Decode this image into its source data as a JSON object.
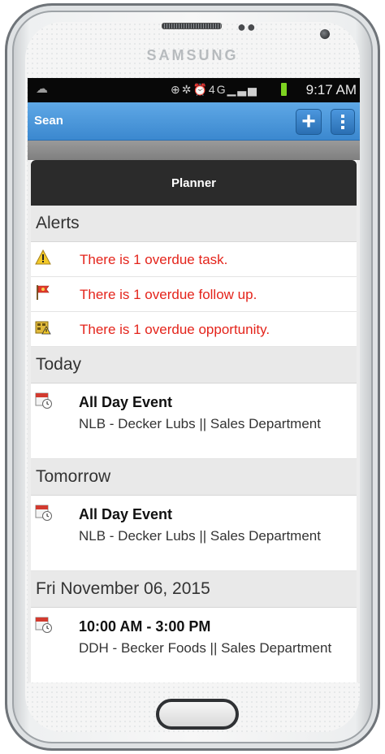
{
  "device": {
    "brand": "SAMSUNG"
  },
  "statusbar": {
    "time": "9:17 AM",
    "network": "4G"
  },
  "appbar": {
    "title": "Sean",
    "add_label": "+"
  },
  "planner": {
    "title": "Planner"
  },
  "alerts": {
    "heading": "Alerts",
    "items": [
      {
        "text": "There is 1 overdue task.",
        "icon": "warning-icon"
      },
      {
        "text": "There is 1 overdue follow up.",
        "icon": "flag-icon"
      },
      {
        "text": "There is 1 overdue opportunity.",
        "icon": "opportunity-icon"
      }
    ]
  },
  "sections": [
    {
      "heading": "Today",
      "event": {
        "title": "All Day Event",
        "detail": "NLB - Decker Lubs || Sales Department"
      }
    },
    {
      "heading": "Tomorrow",
      "event": {
        "title": "All Day Event",
        "detail": "NLB - Decker Lubs || Sales Department"
      }
    },
    {
      "heading": "Fri November 06, 2015",
      "event": {
        "title": "10:00 AM - 3:00 PM",
        "detail": "DDH - Becker Foods || Sales Department"
      }
    }
  ],
  "colors": {
    "alert_text": "#e4241b",
    "appbar": "#4a97dc"
  }
}
